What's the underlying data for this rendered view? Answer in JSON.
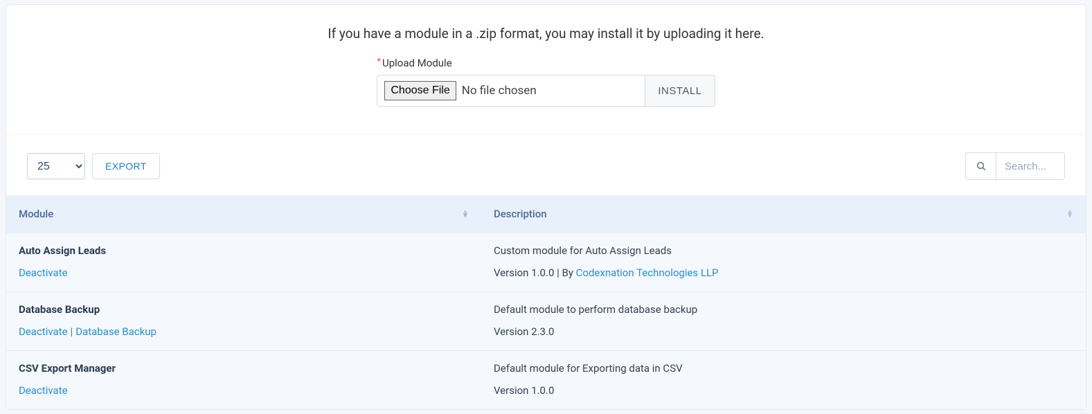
{
  "intro": {
    "text": "If you have a module in a .zip format, you may install it by uploading it here.",
    "upload_label": "Upload Module",
    "choose_file": "Choose File",
    "no_file": "No file chosen",
    "install": "INSTALL"
  },
  "toolbar": {
    "page_size": "25",
    "export": "EXPORT",
    "search_placeholder": "Search..."
  },
  "table": {
    "col_module": "Module",
    "col_description": "Description"
  },
  "modules": [
    {
      "name": "Auto Assign Leads",
      "actions": {
        "deactivate": "Deactivate"
      },
      "description": "Custom module for Auto Assign Leads",
      "version_prefix": "Version 1.0.0 | By ",
      "author": "Codexnation Technologies LLP"
    },
    {
      "name": "Database Backup",
      "actions": {
        "deactivate": "Deactivate",
        "extra": "Database Backup"
      },
      "description": "Default module to perform database backup",
      "version_prefix": "Version 2.3.0",
      "author": ""
    },
    {
      "name": "CSV Export Manager",
      "actions": {
        "deactivate": "Deactivate"
      },
      "description": "Default module for Exporting data in CSV",
      "version_prefix": "Version 1.0.0",
      "author": ""
    }
  ]
}
